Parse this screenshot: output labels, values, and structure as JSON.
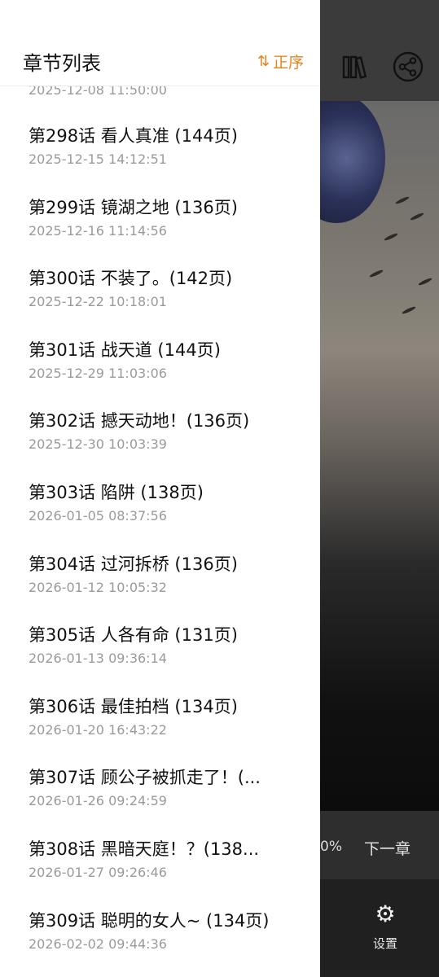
{
  "drawer": {
    "title": "章节列表",
    "sort_label": "正序",
    "sort_icon": "sort-arrow-icon",
    "partial_top_date": "2025-12-08 11:50:00",
    "chapters": [
      {
        "title": "第298话 看人真准 (144页)",
        "date": "2025-12-15 14:12:51"
      },
      {
        "title": "第299话 镜湖之地 (136页)",
        "date": "2025-12-16 11:14:56"
      },
      {
        "title": "第300话 不装了。(142页)",
        "date": "2025-12-22 10:18:01"
      },
      {
        "title": "第301话 战天道 (144页)",
        "date": "2025-12-29 11:03:06"
      },
      {
        "title": "第302话 撼天动地！(136页)",
        "date": "2025-12-30 10:03:39"
      },
      {
        "title": "第303话 陷阱 (138页)",
        "date": "2026-01-05 08:37:56"
      },
      {
        "title": "第304话 过河拆桥 (136页)",
        "date": "2026-01-12 10:05:32"
      },
      {
        "title": "第305话 人各有命 (131页)",
        "date": "2026-01-13 09:36:14"
      },
      {
        "title": "第306话 最佳拍档 (134页)",
        "date": "2026-01-20 16:43:22"
      },
      {
        "title": "第307话 顾公子被抓走了！(...",
        "date": "2026-01-26 09:24:59"
      },
      {
        "title": "第308话 黑暗天庭！？(138...",
        "date": "2026-01-27 09:26:46"
      },
      {
        "title": "第309话 聪明的女人~ (134页)",
        "date": "2026-02-02 09:44:36"
      }
    ]
  },
  "reader": {
    "top_icons": [
      "books-icon",
      "share-icon"
    ],
    "progress_partial": "0%",
    "next_chapter_label": "下一章",
    "settings_label": "设置",
    "settings_icon": "gear-icon"
  }
}
